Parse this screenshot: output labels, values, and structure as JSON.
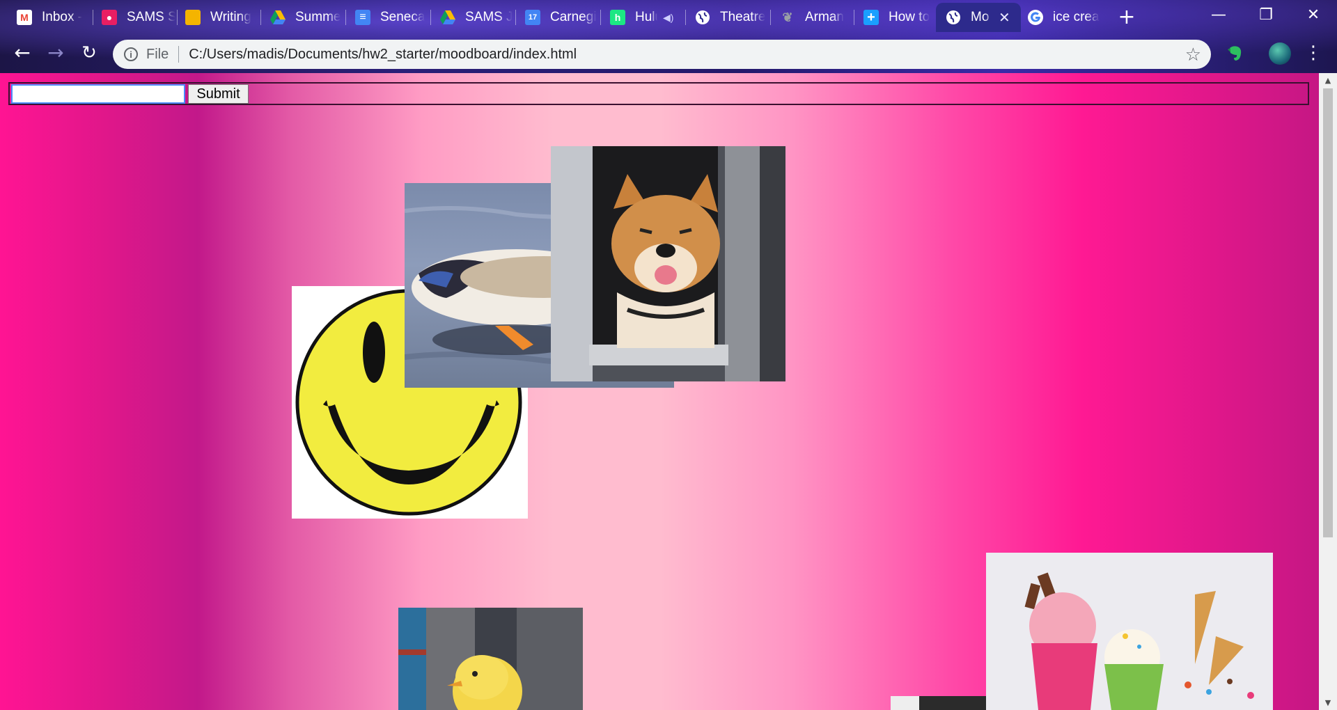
{
  "browser": {
    "tabs": [
      {
        "title": "Inbox -",
        "favicon": "gmail-icon",
        "color": "#ea4335"
      },
      {
        "title": "SAMS S",
        "favicon": "contacts-icon",
        "color": "#e91e63"
      },
      {
        "title": "Writing",
        "favicon": "slides-icon",
        "color": "#f4b400"
      },
      {
        "title": "Summe",
        "favicon": "drive-icon",
        "color": "#34a853"
      },
      {
        "title": "Seneca",
        "favicon": "docs-icon",
        "color": "#4285f4"
      },
      {
        "title": "SAMS J",
        "favicon": "drive-icon",
        "color": "#34a853"
      },
      {
        "title": "Carnegi",
        "favicon": "calendar-icon",
        "color": "#4285f4"
      },
      {
        "title": "Hulu",
        "favicon": "hulu-icon",
        "color": "#1ce783"
      },
      {
        "title": "Theatre",
        "favicon": "globe-icon",
        "color": "#ffffff"
      },
      {
        "title": "Arman",
        "favicon": "feather-icon",
        "color": "#9aa0a6"
      },
      {
        "title": "How to",
        "favicon": "plus-icon",
        "color": "#1a9fff"
      },
      {
        "title": "Mo",
        "favicon": "globe-icon",
        "color": "#ffffff",
        "active": true
      },
      {
        "title": "ice crea",
        "favicon": "google-icon",
        "color": "#ffffff"
      }
    ],
    "calendar_day": "17",
    "address": {
      "scheme": "File",
      "url": "C:/Users/madis/Documents/hw2_starter/moodboard/index.html"
    }
  },
  "page": {
    "input_value": "",
    "submit_label": "Submit"
  }
}
